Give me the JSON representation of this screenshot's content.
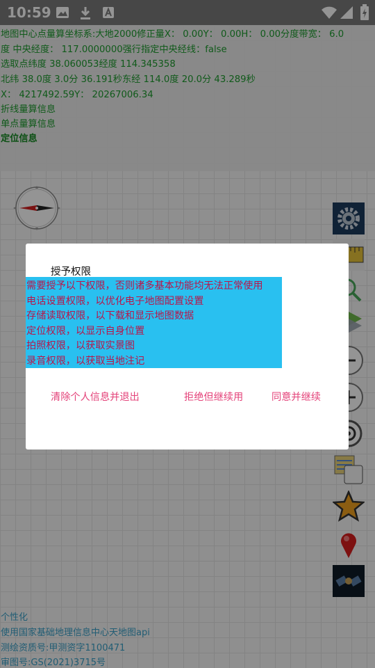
{
  "status_bar": {
    "time": "10:59",
    "icons_left": [
      "image-icon",
      "download-icon",
      "text-a-icon"
    ],
    "icons_right": [
      "wifi-icon",
      "signal-icon",
      "battery-charging-icon"
    ]
  },
  "info_panel": {
    "lines": [
      "地图中心点量算坐标系:大地2000修正量X： 0.00Y： 0.00H： 0.00分度带宽： 6.0",
      "度 中央经度： 117.0000000强行指定中央经线：false",
      "选取点纬度 38.060053经度 114.345358",
      "北纬 38.0度 3.0分 36.191秒东经 114.0度 20.0分 43.289秒",
      "X： 4217492.59Y： 20267006.34",
      "折线量算信息",
      "单点量算信息",
      "定位信息"
    ]
  },
  "bottom_info": {
    "lines": [
      "个性化",
      "使用国家基础地理信息中心天地图api",
      " 测绘资质号:甲测资字1100471",
      " 审图号:GS(2021)3715号"
    ]
  },
  "toolbar": [
    "settings-gear-icon",
    "ruler-icon",
    "zoom-search-icon",
    "layers-icon",
    "zoom-out-icon",
    "zoom-in-icon",
    "locate-target-icon",
    "map-cards-icon",
    "favorite-star-icon",
    "marker-pin-icon",
    "satellite-icon"
  ],
  "dialog": {
    "title": "授予权限",
    "permissions": [
      "需要授予以下权限，否则诸多基本功能均无法正常使用",
      "电话设置权限，以优化电子地图配置设置",
      "存储读取权限，以下载和显示地图数据",
      "定位权限，以显示自身位置",
      "拍照权限，以获取实景图",
      "录音权限，以获取当地注记"
    ],
    "buttons": {
      "clear_exit": "清除个人信息并退出",
      "deny_continue": "拒绝但继续用",
      "agree_continue": "同意并继续"
    }
  },
  "colors": {
    "info_text": "#1d9b2e",
    "permission_bg": "#29c0f0",
    "permission_text": "#b8164a",
    "button_text": "#e4437a",
    "bottom_text": "#3aa0c8"
  }
}
